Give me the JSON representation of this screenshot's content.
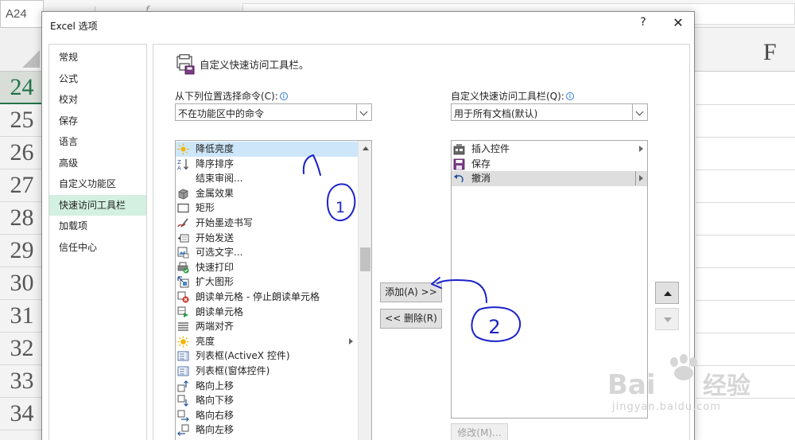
{
  "excel": {
    "name_box": "A24",
    "column_f": "F",
    "rows": [
      "24",
      "25",
      "26",
      "27",
      "28",
      "29",
      "30",
      "31",
      "32",
      "33",
      "34"
    ]
  },
  "dialog": {
    "title": "Excel 选项",
    "help": "?",
    "close": "✕",
    "nav": [
      "常规",
      "公式",
      "校对",
      "保存",
      "语言",
      "高级",
      "自定义功能区",
      "快速访问工具栏",
      "加载项",
      "信任中心"
    ],
    "nav_active_index": 7,
    "section_title": "自定义快速访问工具栏。",
    "choose_label": "从下列位置选择命令(C):",
    "choose_value": "不在功能区中的命令",
    "customize_label": "自定义快速访问工具栏(Q):",
    "customize_value": "用于所有文档(默认)",
    "commands": [
      {
        "label": "降低亮度",
        "icon": "dim-brightness-icon",
        "selected": true
      },
      {
        "label": "降序排序",
        "icon": "sort-descending-icon"
      },
      {
        "label": "结束审阅...",
        "icon": "none"
      },
      {
        "label": "金属效果",
        "icon": "metal-effect-icon"
      },
      {
        "label": "矩形",
        "icon": "rectangle-icon"
      },
      {
        "label": "开始墨迹书写",
        "icon": "ink-pen-icon"
      },
      {
        "label": "开始发送",
        "icon": "send-icon"
      },
      {
        "label": "可选文字...",
        "icon": "alt-text-icon"
      },
      {
        "label": "快速打印",
        "icon": "quick-print-icon"
      },
      {
        "label": "扩大图形",
        "icon": "enlarge-shape-icon"
      },
      {
        "label": "朗读单元格 - 停止朗读单元格",
        "icon": "stop-speak-icon"
      },
      {
        "label": "朗读单元格",
        "icon": "speak-cells-icon"
      },
      {
        "label": "两端对齐",
        "icon": "justify-icon"
      },
      {
        "label": "亮度",
        "icon": "brightness-icon",
        "has_submenu": true
      },
      {
        "label": "列表框(ActiveX 控件)",
        "icon": "listbox-activex-icon"
      },
      {
        "label": "列表框(窗体控件)",
        "icon": "listbox-form-icon"
      },
      {
        "label": "略向上移",
        "icon": "nudge-up-icon"
      },
      {
        "label": "略向下移",
        "icon": "nudge-down-icon"
      },
      {
        "label": "略向右移",
        "icon": "nudge-right-icon"
      },
      {
        "label": "略向左移",
        "icon": "nudge-left-icon"
      }
    ],
    "qat_items": [
      {
        "label": "插入控件",
        "icon": "insert-control-icon",
        "has_submenu": true
      },
      {
        "label": "保存",
        "icon": "save-icon"
      },
      {
        "label": "撤消",
        "icon": "undo-icon",
        "has_submenu": true,
        "selected": true
      }
    ],
    "add_button": "添加(A) >>",
    "remove_button": "<< 删除(R)",
    "modify_button": "修改(M)..."
  },
  "annotations": [
    "1",
    "2"
  ],
  "watermark": {
    "text": "jingyan.baidu.com"
  },
  "colors": {
    "accent": "#217346",
    "nav_active": "#d3f0e0",
    "list_selected": "#cde6fa",
    "annotation_ink": "#1a22c8"
  }
}
